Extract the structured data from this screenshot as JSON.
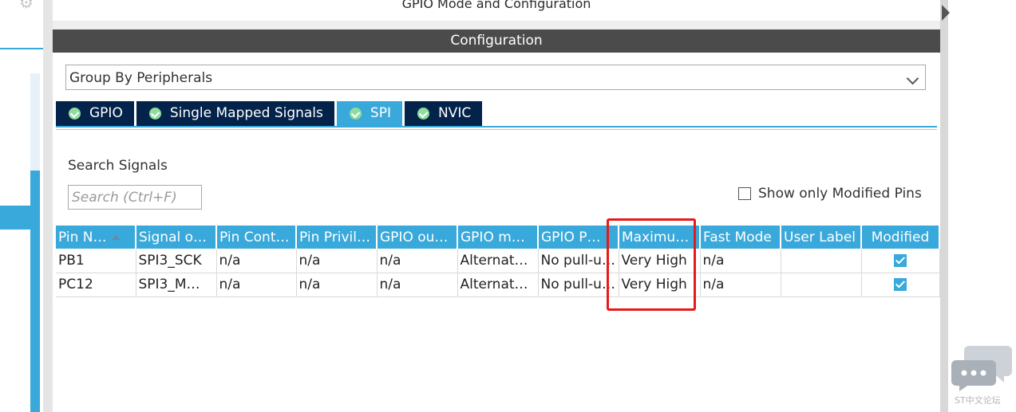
{
  "window": {
    "title": "GPIO Mode and Configuration"
  },
  "config_header": "Configuration",
  "group_by": {
    "value": "Group By Peripherals"
  },
  "tabs": [
    {
      "label": "GPIO",
      "active": false
    },
    {
      "label": "Single Mapped Signals",
      "active": false
    },
    {
      "label": "SPI",
      "active": true
    },
    {
      "label": "NVIC",
      "active": false
    }
  ],
  "search": {
    "label": "Search Signals",
    "placeholder": "Search (Ctrl+F)"
  },
  "show_modified": {
    "label": "Show only Modified Pins",
    "checked": false
  },
  "table": {
    "columns": [
      "Pin N…",
      "Signal o…",
      "Pin Cont…",
      "Pin Privil…",
      "GPIO ou…",
      "GPIO m…",
      "GPIO P…",
      "Maximu…",
      "Fast Mode",
      "User Label",
      "Modified"
    ],
    "rows": [
      [
        "PB1",
        "SPI3_SCK",
        "n/a",
        "n/a",
        "n/a",
        "Alternat…",
        "No pull-u…",
        "Very High",
        "n/a",
        "",
        true
      ],
      [
        "PC12",
        "SPI3_M…",
        "n/a",
        "n/a",
        "n/a",
        "Alternat…",
        "No pull-u…",
        "Very High",
        "n/a",
        "",
        true
      ]
    ]
  },
  "watermark": {
    "text": "ST中文论坛",
    "icon": "chat-bubbles-icon"
  },
  "colors": {
    "accent": "#39a9db",
    "tab_dark": "#03234b",
    "header_dark": "#4b4b4b",
    "highlight": "#e8191b",
    "tab_check": "#8fdc9f"
  }
}
